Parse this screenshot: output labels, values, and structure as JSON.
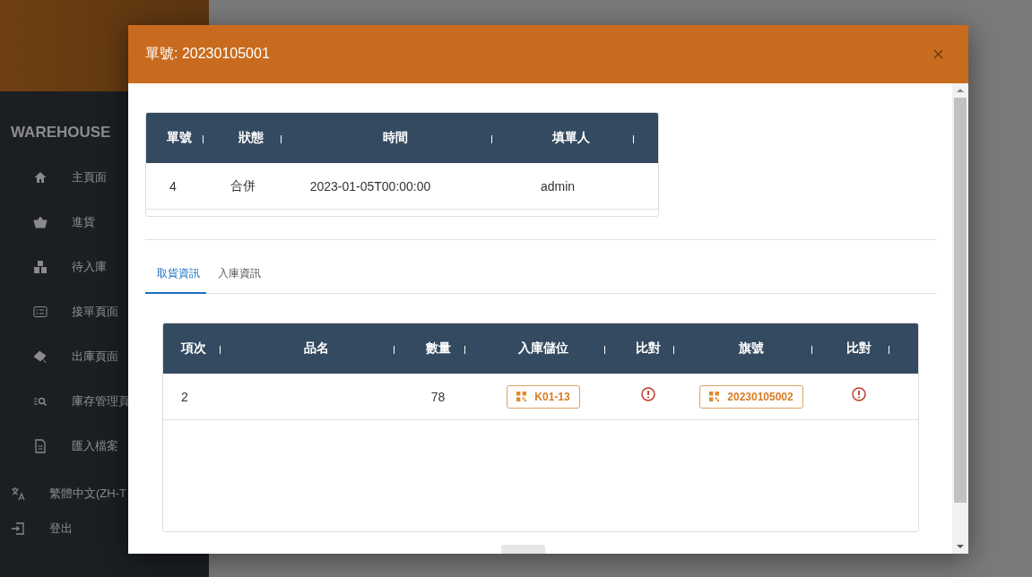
{
  "sidebar": {
    "brand": "WAREHOUSE",
    "items": [
      {
        "label": "主頁面",
        "kind": "home"
      },
      {
        "label": "進貨",
        "kind": "basket"
      },
      {
        "label": "待入庫",
        "kind": "boxes"
      },
      {
        "label": "接單頁面",
        "kind": "checklist"
      },
      {
        "label": "出庫頁面",
        "kind": "outbound"
      },
      {
        "label": "庫存管理頁",
        "kind": "inventory"
      },
      {
        "label": "匯入檔案",
        "kind": "file"
      }
    ],
    "footer": [
      {
        "label": "繁體中文(ZH-T",
        "kind": "language"
      },
      {
        "label": "登出",
        "kind": "logout"
      }
    ]
  },
  "dialog": {
    "title": "單號: 20230105001",
    "order_table": {
      "columns": [
        "單號",
        "狀態",
        "時間",
        "填單人"
      ],
      "rows": [
        [
          "4",
          "合併",
          "2023-01-05T00:00:00",
          "admin"
        ]
      ]
    },
    "tabs": [
      {
        "label": "取貨資訊",
        "selected": true
      },
      {
        "label": "入庫資訊",
        "selected": false
      }
    ],
    "items_table": {
      "columns": [
        "項次",
        "品名",
        "數量",
        "入庫儲位",
        "比對",
        "旗號",
        "比對"
      ],
      "rows": [
        {
          "index": "2",
          "qty": "78",
          "location": "K01-13",
          "location_matched": false,
          "flag": "20230105002",
          "flag_matched": false
        }
      ]
    }
  }
}
